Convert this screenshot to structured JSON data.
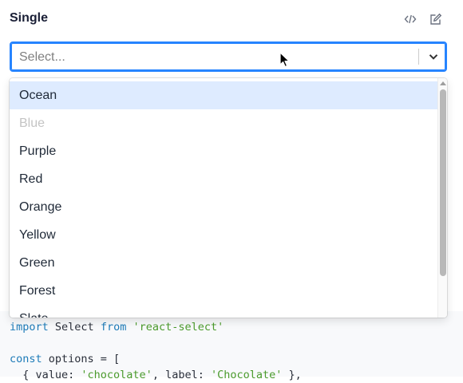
{
  "header": {
    "title": "Single",
    "icons": [
      "code-icon",
      "edit-icon"
    ]
  },
  "select": {
    "placeholder": "Select...",
    "dropdown_icon": "chevron-down-icon"
  },
  "menu": {
    "options": [
      {
        "label": "Ocean",
        "state": "focused"
      },
      {
        "label": "Blue",
        "state": "disabled"
      },
      {
        "label": "Purple",
        "state": "normal"
      },
      {
        "label": "Red",
        "state": "normal"
      },
      {
        "label": "Orange",
        "state": "normal"
      },
      {
        "label": "Yellow",
        "state": "normal"
      },
      {
        "label": "Green",
        "state": "normal"
      },
      {
        "label": "Forest",
        "state": "normal"
      },
      {
        "label": "Slate",
        "state": "normal"
      }
    ]
  },
  "code": {
    "line1": {
      "kw1": "import",
      "ident": " Select ",
      "kw2": "from",
      "str": " 'react-select'"
    },
    "line2": {
      "kw": "const",
      "rest": " options = ["
    },
    "line3": {
      "open": "  { value: ",
      "v": "'chocolate'",
      "mid": ", label: ",
      "l": "'Chocolate'",
      "close": " },"
    }
  },
  "colors": {
    "focus_border": "#2684ff",
    "focused_option_bg": "#deebff",
    "disabled_text": "#c4c4c4"
  }
}
